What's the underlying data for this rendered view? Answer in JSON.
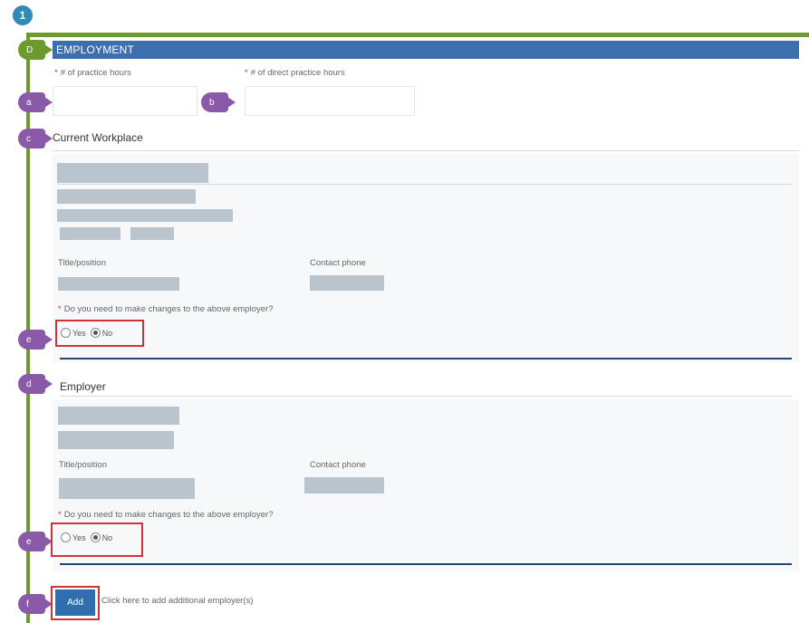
{
  "step": {
    "number": "1"
  },
  "callouts": {
    "section": "D",
    "practice_hours": "a",
    "direct_hours": "b",
    "current_workplace": "c",
    "current_change": "e",
    "employer": "d",
    "employer_change": "e",
    "add": "f"
  },
  "section": {
    "title": "EMPLOYMENT"
  },
  "fields": {
    "practice_hours": {
      "label": "# of practice hours",
      "value": ""
    },
    "direct_hours": {
      "label": "# of direct practice hours",
      "value": ""
    }
  },
  "current_workplace": {
    "title": "Current Workplace",
    "title_position_label": "Title/position",
    "contact_phone_label": "Contact phone",
    "change_question": "Do you need to make changes to the above employer?",
    "options": [
      "Yes",
      "No"
    ],
    "selected": "No"
  },
  "employer": {
    "title": "Employer",
    "title_position_label": "Title/position",
    "contact_phone_label": "Contact phone",
    "change_question": "Do you need to make changes to the above employer?",
    "options": [
      "Yes",
      "No"
    ],
    "selected": "No"
  },
  "add": {
    "button_label": "Add",
    "hint": "Click here to add additional employer(s)"
  },
  "colors": {
    "header_blue": "#3d6eae",
    "guide_green": "#6c9a2e",
    "callout_purple": "#8a5aa8",
    "highlight_red": "#d0323a",
    "step_blue": "#2f8ab5"
  }
}
